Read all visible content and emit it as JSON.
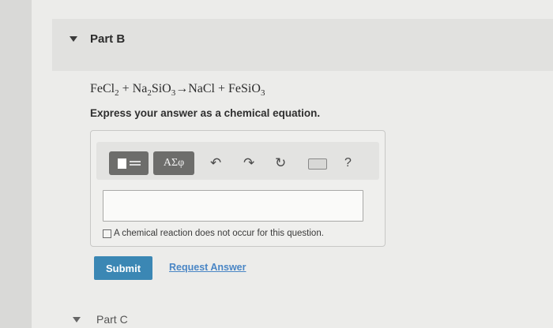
{
  "part_b": {
    "title": "Part B",
    "equation": {
      "reactants": [
        {
          "pre": "FeCl",
          "sub": "2",
          "post": ""
        },
        {
          "pre": "Na",
          "sub": "2",
          "post": "SiO",
          "sub2": "3"
        }
      ],
      "plus": "+",
      "arrow": "→",
      "products": [
        {
          "pre": "NaCl"
        },
        {
          "pre": "FeSiO",
          "sub": "3"
        }
      ]
    },
    "instruction": "Express your answer as a chemical equation.",
    "toolbar": {
      "symbols_label": "ΑΣφ",
      "undo_glyph": "↶",
      "redo_glyph": "↷",
      "reset_glyph": "↻",
      "help_glyph": "?"
    },
    "answer_value": "",
    "no_reaction_label": "A chemical reaction does not occur for this question.",
    "submit_label": "Submit",
    "request_answer_label": "Request Answer"
  },
  "part_c": {
    "title": "Part C"
  },
  "colors": {
    "submit": "#3b87b4",
    "link": "#4a86c5",
    "toolbar_button": "#6d6d6b"
  }
}
